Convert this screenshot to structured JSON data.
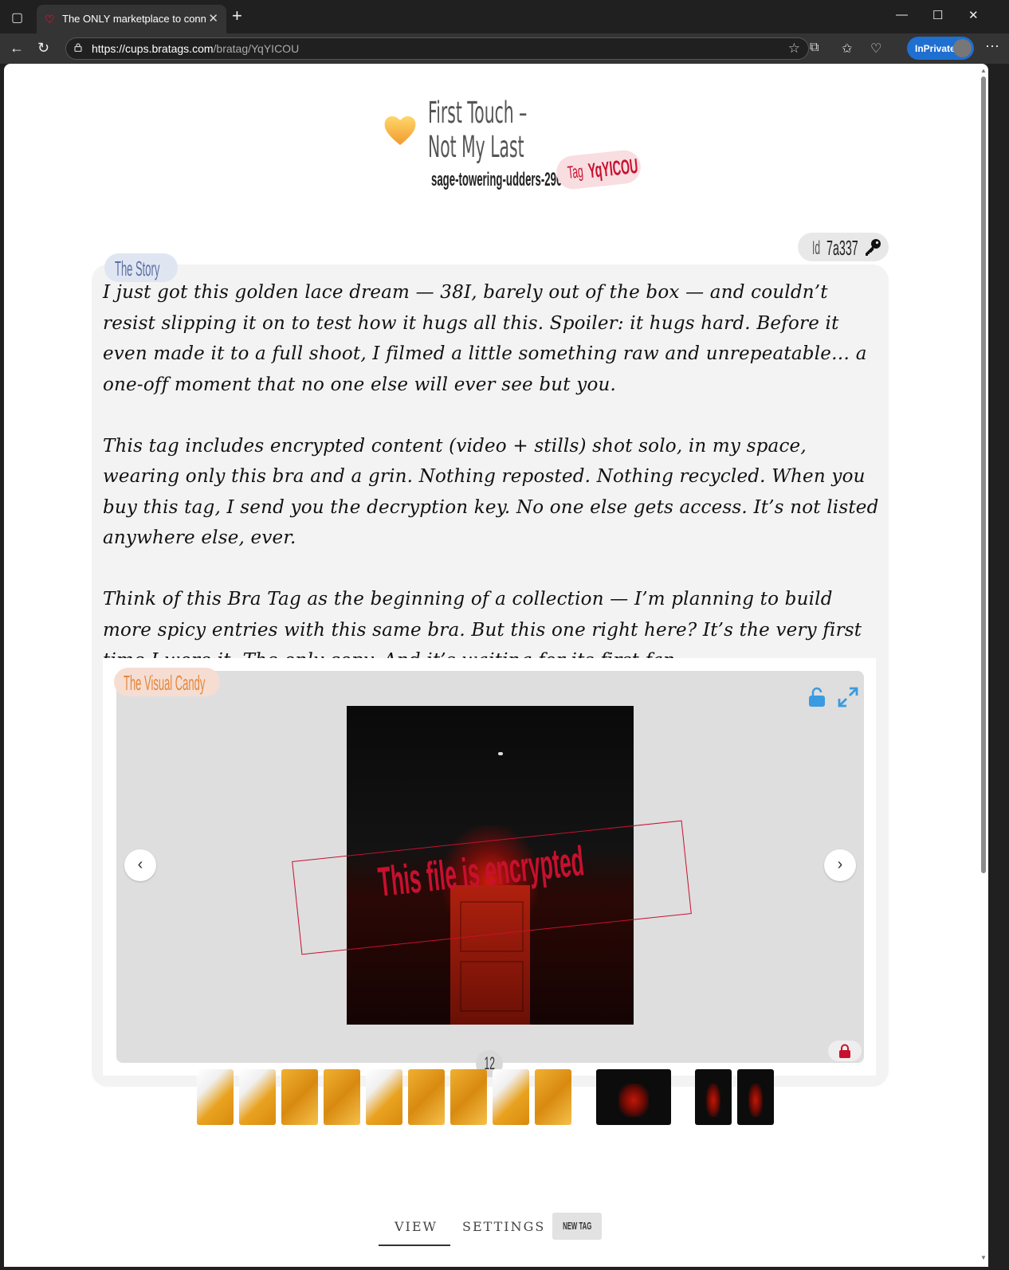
{
  "browser": {
    "tab_title": "The ONLY marketplace to connect",
    "url_host": "https://cups.bratags.com",
    "url_path": "/bratag/YqYICOU",
    "inprivate_label": "InPrivate"
  },
  "page": {
    "title": "First Touch – Not My Last",
    "username": "sage-towering-udders-290",
    "tag_label": "Tag",
    "tag_value": "YqYICOU",
    "id_label": "Id",
    "id_value": "7a337"
  },
  "story": {
    "tab_label": "The Story",
    "paragraphs": [
      "I just got this golden lace dream — 38I, barely out of the box — and couldn’t resist slipping it on to test how it hugs all this. Spoiler: it hugs hard. Before it even made it to a full shoot, I filmed a little something raw and unrepeatable… a one-off moment that no one else will ever see but you.",
      "This tag includes encrypted content (video + stills) shot solo, in my space, wearing only this bra and a grin. Nothing reposted. Nothing recycled. When you buy this tag, I send you the decryption key. No one else gets access. It’s not listed anywhere else, ever.",
      "Think of this Bra Tag as the beginning of a collection — I’m planning to build more spicy entries with this same bra. But this one right here? It’s the very first time I wore it. The only copy. And it’s waiting for its first fan."
    ]
  },
  "visual": {
    "tab_label": "The Visual Candy",
    "encrypted_text": "This file is encrypted",
    "count": "12",
    "thumbnails": [
      {
        "kind": "yellow-white"
      },
      {
        "kind": "yellow-white"
      },
      {
        "kind": "yellow"
      },
      {
        "kind": "yellow"
      },
      {
        "kind": "yellow-white"
      },
      {
        "kind": "yellow"
      },
      {
        "kind": "yellow"
      },
      {
        "kind": "yellow-white"
      },
      {
        "kind": "yellow"
      },
      {
        "kind": "dark"
      },
      {
        "kind": "dark"
      },
      {
        "kind": "dark"
      }
    ]
  },
  "bottom_nav": {
    "view": "VIEW",
    "settings": "SETTINGS",
    "new_tag": "NEW TAG"
  },
  "colors": {
    "accent_red": "#c8102e",
    "story_blue": "#5b6fa3",
    "candy_orange": "#e4863c",
    "icon_blue": "#3b9be0"
  }
}
